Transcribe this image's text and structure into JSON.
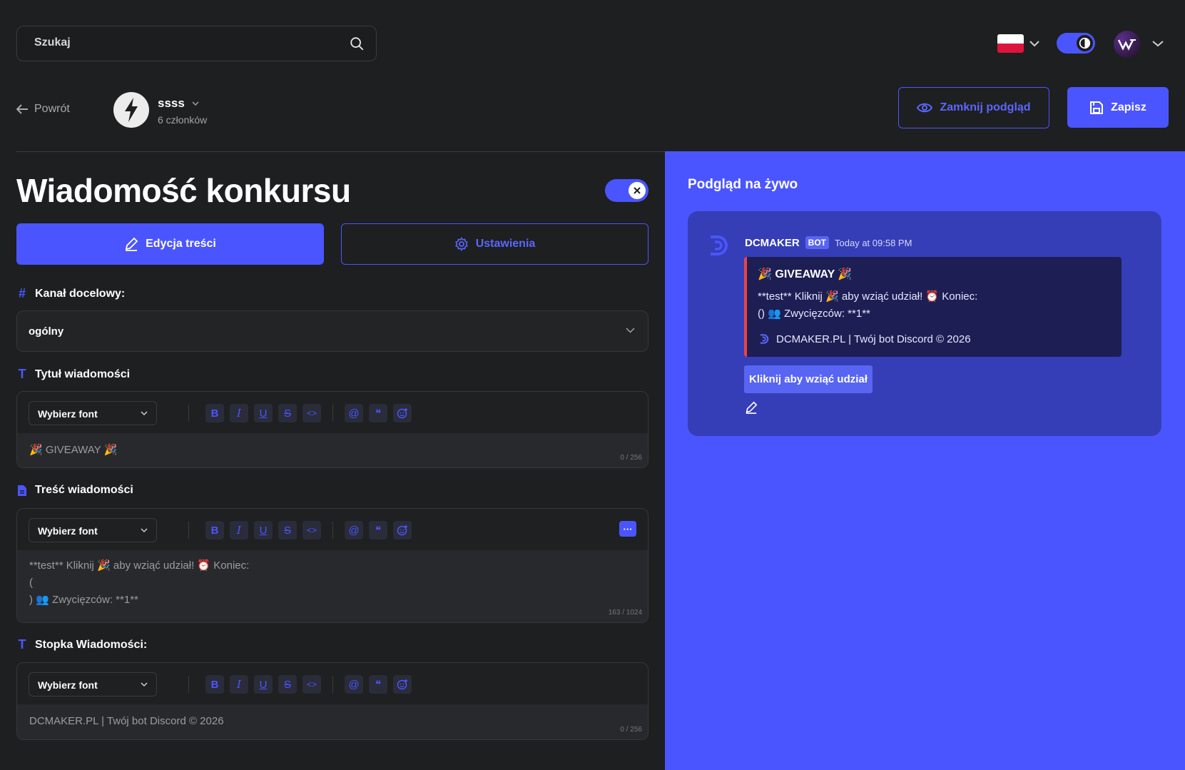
{
  "search": {
    "placeholder": "Szukaj"
  },
  "header": {
    "back_label": "Powrót",
    "server_name": "ssss",
    "server_members": "6 członków",
    "preview_button": "Zamknij podgląd",
    "save_button": "Zapisz"
  },
  "editor": {
    "title": "Wiadomość konkursu",
    "tabs": [
      {
        "label": "Edycja treści"
      },
      {
        "label": "Ustawienia"
      }
    ],
    "channel": {
      "label": "Kanał docelowy:",
      "value": "ogólny"
    },
    "sections": [
      {
        "label": "Tytuł wiadomości",
        "font": "Wybierz font",
        "text": "🎉 GIVEAWAY 🎉",
        "count": "0 / 256"
      },
      {
        "label": "Treść wiadomości",
        "font": "Wybierz font",
        "text": "**test** Kliknij 🎉 aby wziąć udział! ⏰ Koniec:\n(\n) 👥 Zwycięzców: **1**",
        "count": "163 / 1024"
      },
      {
        "label": "Stopka Wiadomości:",
        "font": "Wybierz font",
        "text": "DCMAKER.PL | Twój bot Discord © 2026",
        "count": "0 / 256"
      }
    ],
    "toolbar": {
      "bold": "B",
      "italic": "I",
      "underline": "U",
      "strike": "S",
      "code": "<>",
      "mention": "@",
      "quote": "❝",
      "more": "···"
    }
  },
  "preview": {
    "title": "Podgląd na żywo",
    "bot_name": "DCMAKER",
    "bot_tag": "BOT",
    "time": "Today at 09:58 PM",
    "embed_title": "🎉 GIVEAWAY 🎉",
    "embed_desc": "**test** Kliknij 🎉 aby wziąć udział! ⏰ Koniec:\n() 👥 Zwycięzców: **1**",
    "embed_footer": "DCMAKER.PL | Twój bot Discord © 2026",
    "button": "Kliknij aby wziąć udział"
  },
  "colors": {
    "accent": "#4b55ff",
    "background": "#1e1f20",
    "embed_border": "#ed4245"
  }
}
